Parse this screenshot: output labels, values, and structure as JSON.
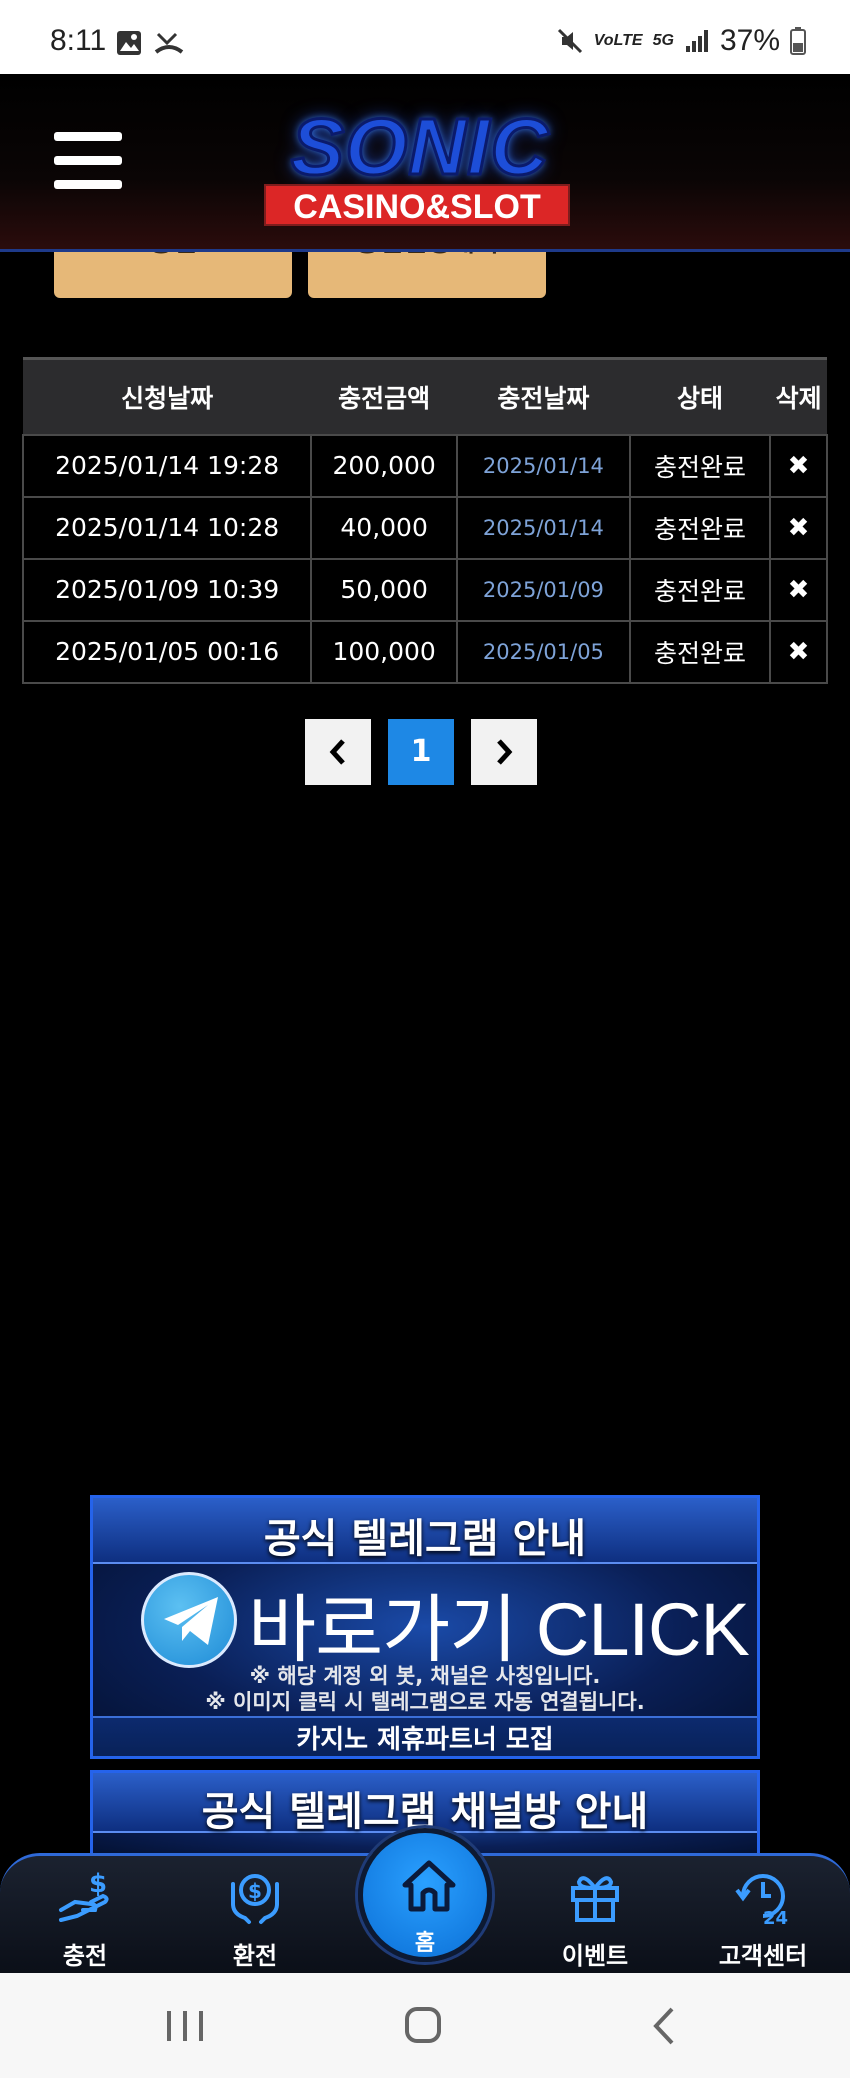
{
  "status_bar": {
    "time": "8:11",
    "network": "5G",
    "battery": "37%"
  },
  "header": {
    "logo_main": "SONIC",
    "logo_sub": "CASINO&SLOT"
  },
  "tabs": [
    {
      "label": "충전"
    },
    {
      "label": "충전신청내역"
    }
  ],
  "table": {
    "headers": [
      "신청날짜",
      "충전금액",
      "충전날짜",
      "상태",
      "삭제"
    ],
    "rows": [
      {
        "request_date": "2025/01/14 19:28",
        "amount": "200,000",
        "charge_date": "2025/01/14",
        "status": "충전완료",
        "delete": "✖"
      },
      {
        "request_date": "2025/01/14 10:28",
        "amount": "40,000",
        "charge_date": "2025/01/14",
        "status": "충전완료",
        "delete": "✖"
      },
      {
        "request_date": "2025/01/09 10:39",
        "amount": "50,000",
        "charge_date": "2025/01/09",
        "status": "충전완료",
        "delete": "✖"
      },
      {
        "request_date": "2025/01/05 00:16",
        "amount": "100,000",
        "charge_date": "2025/01/05",
        "status": "충전완료",
        "delete": "✖"
      }
    ]
  },
  "pagination": {
    "prev": "‹",
    "current": "1",
    "next": "›"
  },
  "banners": {
    "telegram_guide": {
      "title": "공식 텔레그램 안내",
      "click_text": "바로가기 CLICK",
      "note_1": "※ 해당 계정 외 봇, 채널은 사칭입니다.",
      "note_2": "※ 이미지 클릭 시 텔레그램으로 자동 연결됩니다.",
      "footer": "카지노 제휴파트너 모집"
    },
    "telegram_channel": {
      "title": "공식 텔레그램 채널방 안내"
    }
  },
  "bottom_nav": {
    "charge": "충전",
    "exchange": "환전",
    "home": "홈",
    "event": "이벤트",
    "support": "고객센터"
  },
  "colors": {
    "accent_blue": "#1e88e5",
    "tab_gold": "#e6b878",
    "charge_date_text": "#7ea3d8"
  }
}
